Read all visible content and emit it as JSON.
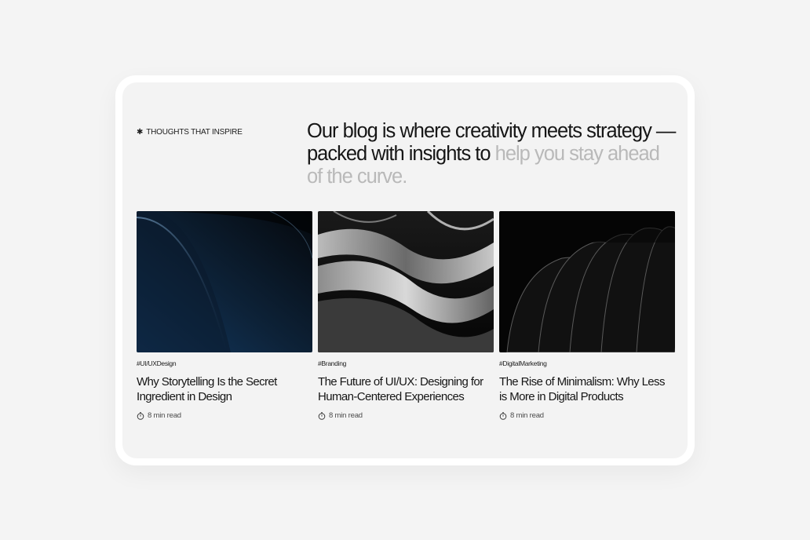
{
  "section": {
    "eyebrow_icon": "asterisk-icon",
    "eyebrow": "THOUGHTS THAT INSPIRE",
    "headline_strong": "Our blog is where creativity meets strategy — packed with insights to ",
    "headline_muted": "help you stay ahead of the curve."
  },
  "posts": [
    {
      "image": "dark-blue-abstract-curve",
      "tag": "#UI/UXDesign",
      "title": "Why Storytelling Is the Secret Ingredient in Design",
      "read_icon": "clock-icon",
      "read_time": "8 min read"
    },
    {
      "image": "silver-wave-abstract",
      "tag": "#Branding",
      "title": "The Future of UI/UX: Designing for Human-Centered Experiences",
      "read_icon": "clock-icon",
      "read_time": "8 min read"
    },
    {
      "image": "black-layered-shapes",
      "tag": "#DigitalMarketing",
      "title": "The Rise of Minimalism: Why Less is More in Digital Products",
      "read_icon": "clock-icon",
      "read_time": "8 min read"
    }
  ],
  "colors": {
    "background": "#f4f4f4",
    "panel": "#f3f3f3",
    "text": "#161616",
    "muted_text": "#b9b9b9"
  }
}
